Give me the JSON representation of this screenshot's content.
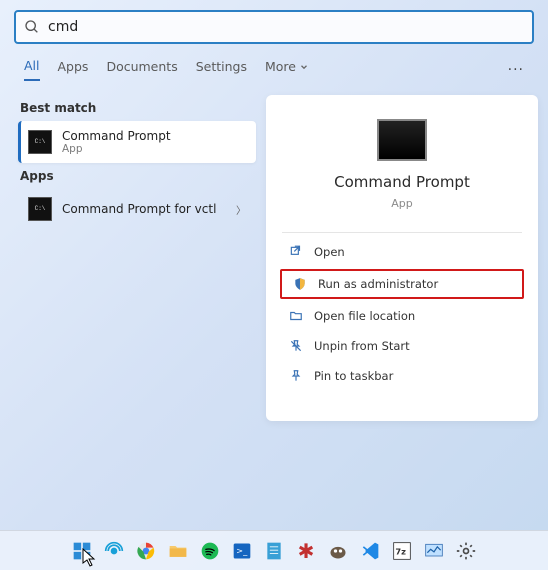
{
  "search": {
    "value": "cmd"
  },
  "tabs": {
    "items": [
      "All",
      "Apps",
      "Documents",
      "Settings",
      "More"
    ],
    "active": 0
  },
  "left": {
    "best_match_label": "Best match",
    "apps_label": "Apps",
    "best_match": {
      "title": "Command Prompt",
      "subtitle": "App"
    },
    "apps": [
      {
        "title": "Command Prompt for vctl"
      }
    ]
  },
  "details": {
    "title": "Command Prompt",
    "subtitle": "App",
    "actions": {
      "open": "Open",
      "run_admin": "Run as administrator",
      "open_location": "Open file location",
      "unpin_start": "Unpin from Start",
      "pin_taskbar": "Pin to taskbar"
    }
  }
}
